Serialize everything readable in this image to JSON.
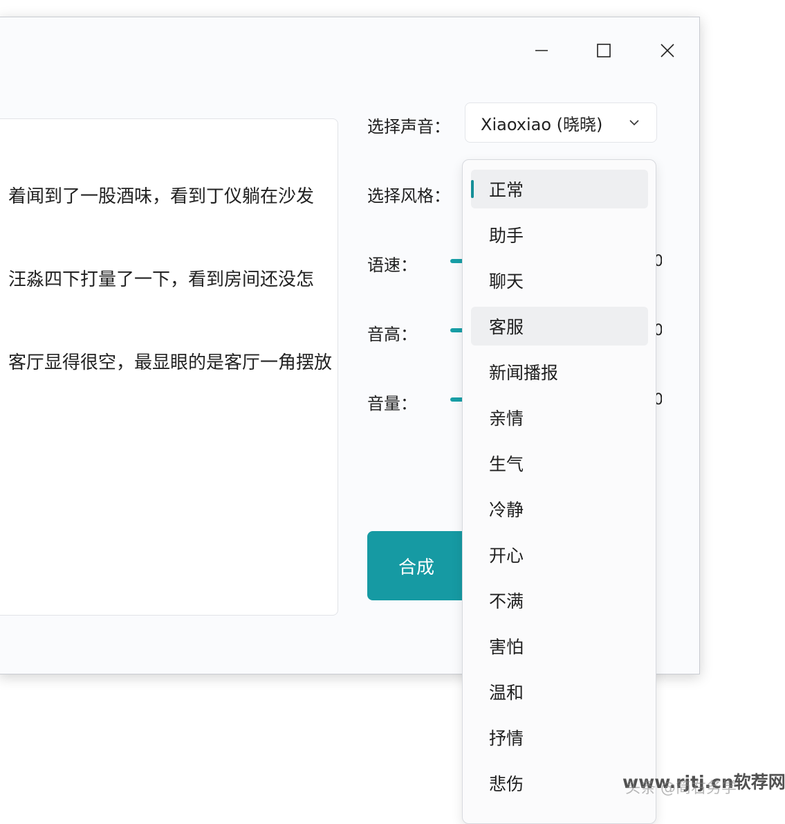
{
  "window": {
    "controls": {
      "minimize_icon": "minimize-icon",
      "maximize_icon": "maximize-icon",
      "close_icon": "close-icon"
    }
  },
  "text_input": {
    "lines": [
      "着闻到了一股酒味，看到丁仪躺在沙发",
      "汪淼四下打量了一下，看到房间还没怎",
      "客厅显得很空，最显眼的是客厅一角摆放"
    ]
  },
  "settings": {
    "voice_label": "选择声音：",
    "voice_value": "Xiaoxiao (晓晓)",
    "style_label": "选择风格：",
    "rate_label": "语速：",
    "pitch_label": "音高：",
    "volume_label": "音量：",
    "rate_value": "0",
    "pitch_value": "0",
    "volume_value": "0"
  },
  "synthesize_button": "合成",
  "style_dropdown": {
    "selected_index": 0,
    "hover_index": 3,
    "options": [
      "正常",
      "助手",
      "聊天",
      "客服",
      "新闻播报",
      "亲情",
      "生气",
      "冷静",
      "开心",
      "不满",
      "害怕",
      "温和",
      "抒情",
      "悲伤"
    ]
  },
  "watermark": {
    "text": "www.rjtj.cn软荐网",
    "sub": "头条 @简右务学"
  },
  "colors": {
    "accent": "#169aa3",
    "window_bg": "#fafbfd"
  }
}
